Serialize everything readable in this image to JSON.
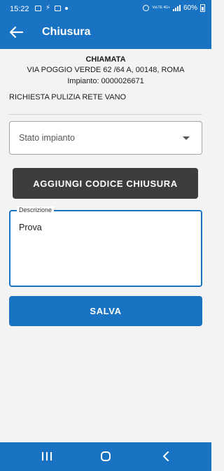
{
  "status_bar": {
    "time": "15:22",
    "network_label": "VoLTE 4G+",
    "battery": "60%"
  },
  "appbar": {
    "title": "Chiusura"
  },
  "call": {
    "heading": "CHIAMATA",
    "address": "VIA POGGIO VERDE 62 /64 A, 00148, ROMA",
    "plant": "Impianto: 0000026671",
    "request": "RICHIESTA PULIZIA RETE VANO"
  },
  "form": {
    "stato_impianto": {
      "placeholder": "Stato impianto"
    },
    "add_code_button": "AGGIUNGI CODICE CHIUSURA",
    "descrizione": {
      "label": "Descrizione",
      "value": "Prova"
    },
    "save_button": "SALVA"
  },
  "colors": {
    "primary": "#1a73c2",
    "dark_button": "#3d3d3d",
    "background": "#f3f3f3"
  }
}
